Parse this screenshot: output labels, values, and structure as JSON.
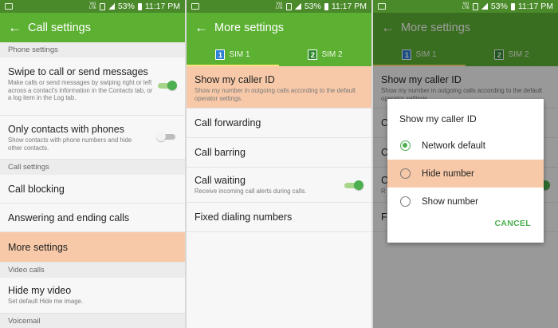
{
  "status_bar": {
    "battery": "53%",
    "time": "11:17 PM",
    "lte_label": "Vo) LTE"
  },
  "colors": {
    "appbar": "#5cb032",
    "statusbar": "#4a8a2a",
    "accent": "#4caf50",
    "highlight": "#f7c9a8",
    "tab_indicator": "#ffe27a"
  },
  "screen1": {
    "title": "Call settings",
    "sections": {
      "phone_settings": "Phone settings",
      "call_settings": "Call settings",
      "video_calls": "Video calls",
      "voicemail": "Voicemail"
    },
    "swipe": {
      "title": "Swipe to call or send messages",
      "subtitle": "Make calls or send messages by swiping right or left across a contact's information in the Contacts tab, or a log item in the Log tab.",
      "toggle_on": true
    },
    "only_contacts": {
      "title": "Only contacts with phones",
      "subtitle": "Show contacts with phone numbers and hide other contacts.",
      "toggle_on": false
    },
    "call_blocking": "Call blocking",
    "answering": "Answering and ending calls",
    "more_settings": "More settings",
    "hide_video": {
      "title": "Hide my video",
      "subtitle": "Set default Hide me image."
    }
  },
  "screen2": {
    "title": "More settings",
    "tabs": [
      {
        "badge": "1",
        "label": "SIM 1"
      },
      {
        "badge": "2",
        "label": "SIM 2"
      }
    ],
    "caller_id": {
      "title": "Show my caller ID",
      "subtitle": "Show my number in outgoing calls according to the default operator settings."
    },
    "call_forwarding": "Call forwarding",
    "call_barring": "Call barring",
    "call_waiting": {
      "title": "Call waiting",
      "subtitle": "Receive incoming call alerts during calls.",
      "toggle_on": true
    },
    "fixed_dialing": "Fixed dialing numbers"
  },
  "screen3": {
    "title": "More settings",
    "bg_caller_id": {
      "title": "Show my caller ID",
      "subtitle": "Show my number in outgoing calls according to the default operator settings."
    },
    "bg_rows": [
      "C",
      "C",
      "C",
      "F"
    ],
    "bg_row_sub": "R",
    "dialog": {
      "title": "Show my caller ID",
      "options": [
        {
          "label": "Network default",
          "selected": true
        },
        {
          "label": "Hide number",
          "selected": false
        },
        {
          "label": "Show number",
          "selected": false
        }
      ],
      "cancel": "CANCEL"
    }
  },
  "icons": {
    "back": "arrow-left-icon"
  }
}
